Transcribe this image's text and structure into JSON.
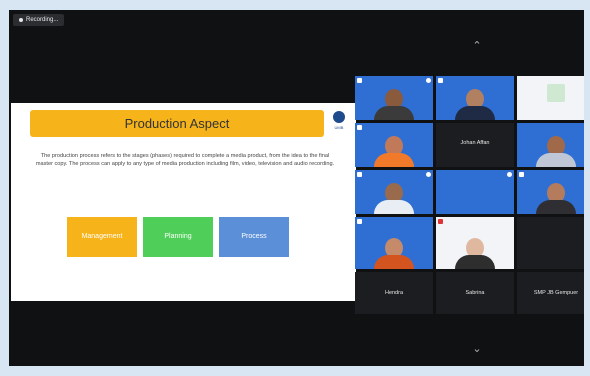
{
  "recording": {
    "label": "Recording..."
  },
  "slide": {
    "title": "Production Aspect",
    "body": "The production process refers to the stages (phases) required to complete a media product, from the idea to the final master copy. The process can apply to any type of media production including film, video, television and audio recording.",
    "logo_text": "UMB",
    "phases": [
      {
        "label": "Management",
        "color": "#f6b41a"
      },
      {
        "label": "Planning",
        "color": "#4fcf5a"
      },
      {
        "label": "Process",
        "color": "#5b8fd8"
      }
    ]
  },
  "participants": [
    {
      "name": "",
      "style": "blue"
    },
    {
      "name": "",
      "style": "blue"
    },
    {
      "name": "",
      "style": "white"
    },
    {
      "name": "",
      "style": "blue"
    },
    {
      "name": "Johan Affan",
      "style": "dark"
    },
    {
      "name": "",
      "style": "blue"
    },
    {
      "name": "",
      "style": "blue"
    },
    {
      "name": "",
      "style": "blue"
    },
    {
      "name": "",
      "style": "blue"
    },
    {
      "name": "",
      "style": "blue"
    },
    {
      "name": "",
      "style": "white"
    },
    {
      "name": "",
      "style": "dark"
    },
    {
      "name": "Hendra",
      "style": "dark"
    },
    {
      "name": "Sabrina",
      "style": "dark"
    },
    {
      "name": "SMP JB Gempuer",
      "style": "dark"
    }
  ],
  "controls": {
    "up_icon": "chevron-up-icon",
    "down_icon": "chevron-down-icon"
  }
}
